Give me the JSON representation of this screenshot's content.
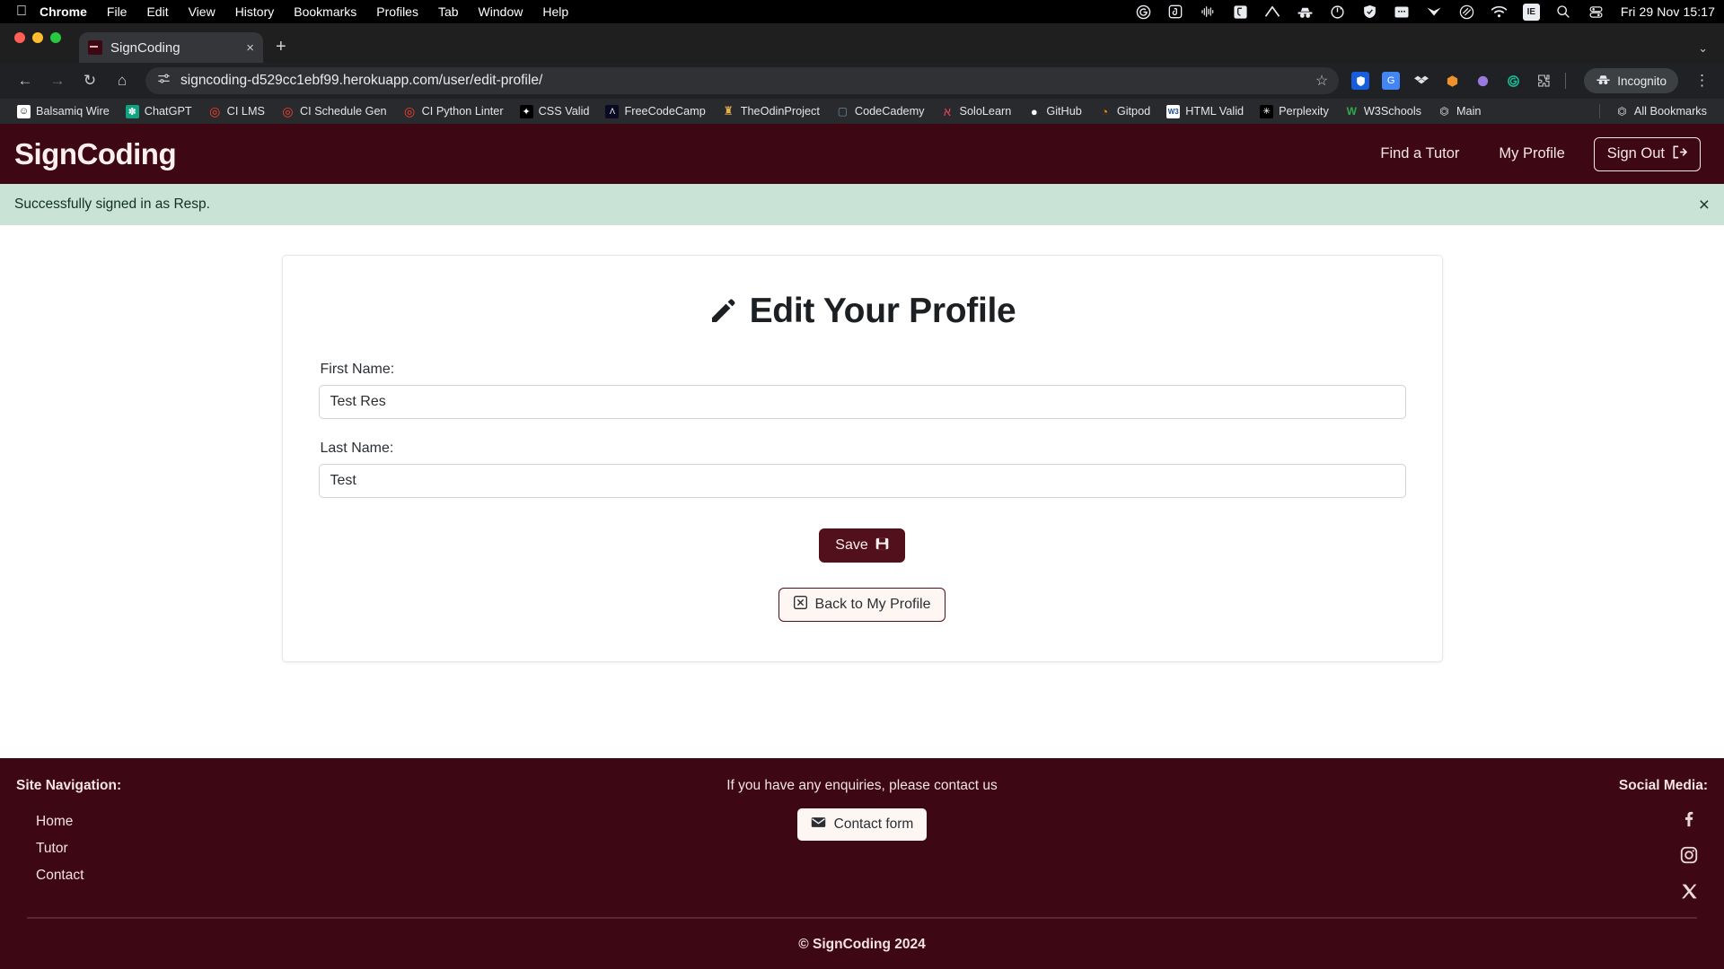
{
  "os_menubar": {
    "apple_icon": "apple-icon",
    "items": [
      "Chrome",
      "File",
      "Edit",
      "View",
      "History",
      "Bookmarks",
      "Profiles",
      "Tab",
      "Window",
      "Help"
    ],
    "tray_icons": [
      "grammarly-icon",
      "joplin-icon",
      "audio-waveform-icon",
      "bitwarden-icon",
      "nordvpn-icon",
      "incognito-icon",
      "sync-icon",
      "shield-icon",
      "window-icon",
      "chevron-down-icon",
      "dropbox-icon",
      "wifi-icon",
      "ie-icon",
      "search-icon",
      "control-center-icon"
    ],
    "clock": "Fri 29 Nov  15:17"
  },
  "browser": {
    "tab": {
      "title": "SignCoding",
      "favicon": "signcoding-favicon",
      "close": "×"
    },
    "new_tab": "+",
    "tab_list_chevron": "⌄",
    "nav": {
      "back": "←",
      "forward": "→",
      "reload": "↻",
      "home": "⌂"
    },
    "omnibox": {
      "site_info_icon": "tune-icon",
      "url": "signcoding-d529cc1ebf99.herokuapp.com/user/edit-profile/",
      "bookmark_star": "☆"
    },
    "extensions": [
      "bitwarden-ext-icon",
      "google-translate-ext-icon",
      "dropbox-ext-icon",
      "honey-ext-icon",
      "colorzilla-ext-icon",
      "grammarly-ext-icon",
      "puzzle-ext-icon"
    ],
    "incognito_label": "Incognito",
    "menu_kebab": "⋮",
    "bookmarks": [
      {
        "label": "Balsamiq Wire",
        "icon": "balsamiq-icon",
        "color": "#ffffff",
        "fg": "#111111",
        "glyph": "☺"
      },
      {
        "label": "ChatGPT",
        "icon": "chatgpt-icon",
        "color": "#10a37f",
        "fg": "#ffffff",
        "glyph": "✽"
      },
      {
        "label": "CI LMS",
        "icon": "codeinstitute-icon",
        "color": "transparent",
        "fg": "#ff3d2e",
        "glyph": "◎"
      },
      {
        "label": "CI Schedule Gen",
        "icon": "codeinstitute-icon",
        "color": "transparent",
        "fg": "#ff3d2e",
        "glyph": "◎"
      },
      {
        "label": "CI Python Linter",
        "icon": "codeinstitute-icon",
        "color": "transparent",
        "fg": "#ff3d2e",
        "glyph": "◎"
      },
      {
        "label": "CSS Valid",
        "icon": "w3c-css-icon",
        "color": "#000000",
        "fg": "#ffffff",
        "glyph": "✦"
      },
      {
        "label": "FreeCodeCamp",
        "icon": "freecodecamp-icon",
        "color": "#0a0a23",
        "fg": "#ffffff",
        "glyph": "Λ"
      },
      {
        "label": "TheOdinProject",
        "icon": "odinproject-icon",
        "color": "transparent",
        "fg": "#e8b04b",
        "glyph": "♜"
      },
      {
        "label": "CodeCademy",
        "icon": "codecademy-icon",
        "color": "transparent",
        "fg": "#6d8ea0",
        "glyph": "▢"
      },
      {
        "label": "SoloLearn",
        "icon": "sololearn-icon",
        "color": "transparent",
        "fg": "#e8425a",
        "glyph": "ॐ"
      },
      {
        "label": "GitHub",
        "icon": "github-icon",
        "color": "transparent",
        "fg": "#ffffff",
        "glyph": "●"
      },
      {
        "label": "Gitpod",
        "icon": "gitpod-icon",
        "color": "transparent",
        "fg": "#ff8a00",
        "glyph": "◔"
      },
      {
        "label": "HTML Valid",
        "icon": "w3c-html-icon",
        "color": "#ffffff",
        "fg": "#1a4b9c",
        "glyph": "W3"
      },
      {
        "label": "Perplexity",
        "icon": "perplexity-icon",
        "color": "#000000",
        "fg": "#ffffff",
        "glyph": "✳"
      },
      {
        "label": "W3Schools",
        "icon": "w3schools-icon",
        "color": "transparent",
        "fg": "#31a94c",
        "glyph": "W"
      },
      {
        "label": "Main",
        "icon": "folder-icon",
        "color": "transparent",
        "fg": "#cfd2d6",
        "glyph": "▭"
      }
    ],
    "all_bookmarks": {
      "label": "All Bookmarks",
      "icon": "folder-icon",
      "glyph": "▭"
    }
  },
  "site": {
    "brand": "SignCoding",
    "nav_links": [
      "Find a Tutor",
      "My Profile"
    ],
    "sign_out": {
      "label": "Sign Out",
      "icon": "sign-out-icon"
    },
    "alert": {
      "message": "Successfully signed in as Resp.",
      "close": "×"
    },
    "card": {
      "title": "Edit Your Profile",
      "title_icon": "pencil-icon",
      "fields": [
        {
          "label": "First Name:",
          "value": "Test Res",
          "name": "first-name-field"
        },
        {
          "label": "Last Name:",
          "value": "Test",
          "name": "last-name-field"
        }
      ],
      "save": {
        "label": "Save",
        "icon": "save-disk-icon"
      },
      "back": {
        "label": "Back to My Profile",
        "icon": "back-box-icon"
      }
    },
    "footer": {
      "nav_title": "Site Navigation:",
      "nav_links": [
        "Home",
        "Tutor",
        "Contact"
      ],
      "enquiry_text": "If you have any enquiries, please contact us",
      "contact_button": {
        "label": "Contact form",
        "icon": "envelope-icon"
      },
      "social_title": "Social Media:",
      "socials": [
        "facebook-icon",
        "instagram-icon",
        "x-twitter-icon"
      ],
      "copyright": "© SignCoding 2024"
    }
  },
  "colors": {
    "brand_maroon": "#3d0713",
    "button_maroon": "#51101c",
    "cream": "#fdf0ec",
    "alert_green_bg": "#c9e3d6",
    "alert_green_fg": "#123026"
  }
}
